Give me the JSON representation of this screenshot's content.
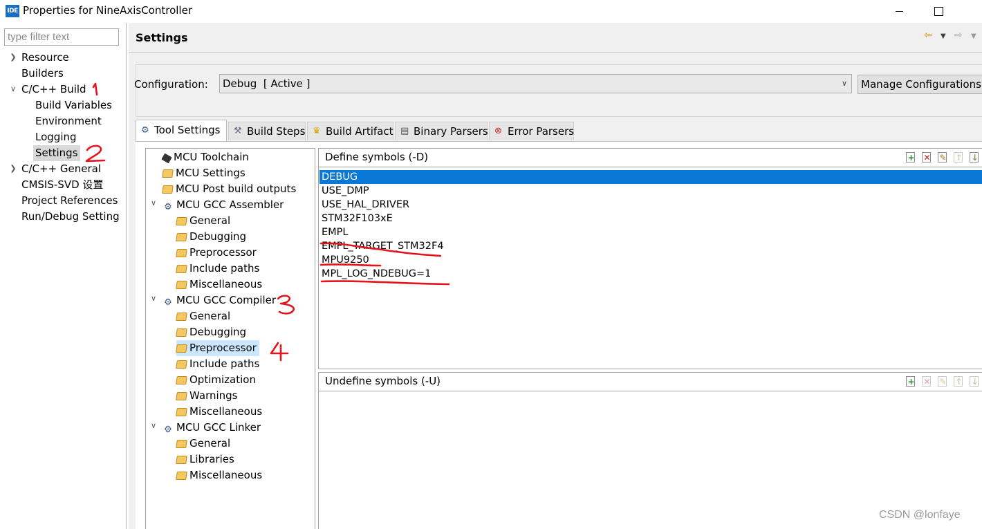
{
  "window": {
    "app_icon_text": "IDE",
    "title": "Properties for NineAxisController"
  },
  "left_nav": {
    "filter_placeholder": "type filter text",
    "items": [
      {
        "label": "Resource",
        "expandable": true
      },
      {
        "label": "Builders"
      },
      {
        "label": "C/C++ Build",
        "expanded": true
      },
      {
        "label": "Build Variables"
      },
      {
        "label": "Environment"
      },
      {
        "label": "Logging"
      },
      {
        "label": "Settings",
        "selected": true
      },
      {
        "label": "C/C++ General",
        "expandable": true
      },
      {
        "label": "CMSIS-SVD 设置"
      },
      {
        "label": "Project References"
      },
      {
        "label": "Run/Debug Setting"
      }
    ]
  },
  "header": {
    "title": "Settings"
  },
  "configuration": {
    "label": "Configuration:",
    "value": "Debug  [ Active ]",
    "manage_button": "Manage Configurations..."
  },
  "tabs": [
    {
      "label": "Tool Settings",
      "icon": "gear-icon",
      "active": true
    },
    {
      "label": "Build Steps",
      "icon": "hammer-icon"
    },
    {
      "label": "Build Artifact",
      "icon": "trophy-icon"
    },
    {
      "label": "Binary Parsers",
      "icon": "binary-file-icon"
    },
    {
      "label": "Error Parsers",
      "icon": "error-icon"
    }
  ],
  "tool_tree": [
    {
      "label": "MCU Toolchain"
    },
    {
      "label": "MCU Settings"
    },
    {
      "label": "MCU Post build outputs"
    },
    {
      "label": "MCU GCC Assembler",
      "expanded": true
    },
    {
      "label": "General"
    },
    {
      "label": "Debugging"
    },
    {
      "label": "Preprocessor"
    },
    {
      "label": "Include paths"
    },
    {
      "label": "Miscellaneous"
    },
    {
      "label": "MCU GCC Compiler",
      "expanded": true
    },
    {
      "label": "General"
    },
    {
      "label": "Debugging"
    },
    {
      "label": "Preprocessor",
      "selected": true
    },
    {
      "label": "Include paths"
    },
    {
      "label": "Optimization"
    },
    {
      "label": "Warnings"
    },
    {
      "label": "Miscellaneous"
    },
    {
      "label": "MCU GCC Linker",
      "expanded": true
    },
    {
      "label": "General"
    },
    {
      "label": "Libraries"
    },
    {
      "label": "Miscellaneous"
    }
  ],
  "define_symbols": {
    "title": "Define symbols (-D)",
    "items": [
      "DEBUG",
      "USE_DMP",
      "USE_HAL_DRIVER",
      "STM32F103xE",
      "EMPL",
      "EMPL_TARGET_STM32F4",
      "MPU9250",
      "MPL_LOG_NDEBUG=1"
    ],
    "selected_index": 0
  },
  "undefine_symbols": {
    "title": "Undefine symbols (-U)",
    "items": []
  },
  "annotations": {
    "color": "#e3141b",
    "marks": [
      "1",
      "2",
      "3",
      "4"
    ]
  },
  "watermark": "CSDN @lonfaye"
}
